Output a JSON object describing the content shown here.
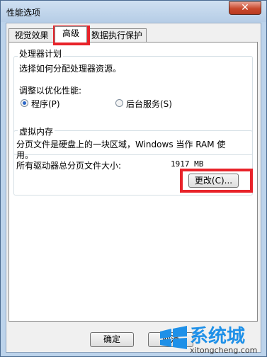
{
  "window": {
    "title": "性能选项",
    "close_label": "✕"
  },
  "tabs": [
    {
      "label": "视觉效果"
    },
    {
      "label": "高级"
    },
    {
      "label": "数据执行保护"
    }
  ],
  "processor": {
    "group_title": "处理器计划",
    "description": "选择如何分配处理器资源。",
    "adjust_label": "调整以优化性能:",
    "options": [
      {
        "label": "程序(P)",
        "checked": true
      },
      {
        "label": "后台服务(S)",
        "checked": false
      }
    ]
  },
  "virtual_memory": {
    "group_title": "虚拟内存",
    "description_line1": "分页文件是硬盘上的一块区域，Windows 当作 RAM 使",
    "description_line2": "用。",
    "total_label": "所有驱动器总分页文件大小:",
    "total_value": "1917 MB",
    "change_button": "更改(C)..."
  },
  "footer": {
    "ok_label": "确定",
    "cancel_label": "取消"
  },
  "watermark": {
    "brand": "系统城",
    "url": "xitongcheng.com"
  },
  "highlight_color": "#e8232a"
}
